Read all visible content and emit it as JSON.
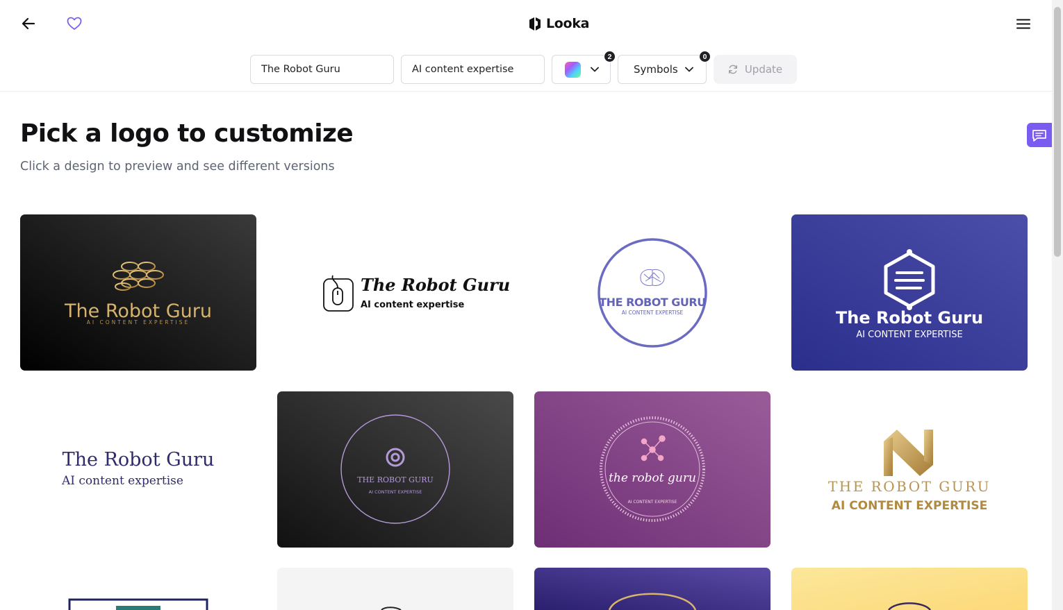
{
  "app": {
    "brand": "Looka"
  },
  "header": {
    "back_icon": "arrow-left-icon",
    "favorite_icon": "heart-outline-icon",
    "menu_icon": "hamburger-menu-icon"
  },
  "search": {
    "company_name": "The Robot Guru",
    "slogan": "AI content expertise",
    "colors_count": "2",
    "symbols_label": "Symbols",
    "symbols_count": "0",
    "update_label": "Update"
  },
  "page": {
    "title": "Pick a logo to customize",
    "subtitle": "Click a design to preview and see different versions"
  },
  "logos": [
    {
      "name": "The Robot Guru",
      "tagline": "AI CONTENT EXPERTISE"
    },
    {
      "name": "The Robot Guru",
      "tagline": "AI content expertise"
    },
    {
      "name": "THE ROBOT GURU",
      "tagline": "AI CONTENT EXPERTISE"
    },
    {
      "name": "The Robot Guru",
      "tagline": "AI CONTENT EXPERTISE"
    },
    {
      "name": "The Robot Guru",
      "tagline": "AI content expertise"
    },
    {
      "name": "THE ROBOT GURU",
      "tagline": "AI CONTENT EXPERTISE"
    },
    {
      "name": "the robot guru",
      "tagline": "AI CONTENT EXPERTISE"
    },
    {
      "name": "THE ROBOT GURU",
      "tagline": "AI CONTENT EXPERTISE"
    }
  ],
  "colors": {
    "accent": "#7b5cf0",
    "gold": "#c9a55c",
    "navy": "#2f318f",
    "lavender": "#7a7ac8",
    "purple_card": "#7f3c82"
  }
}
